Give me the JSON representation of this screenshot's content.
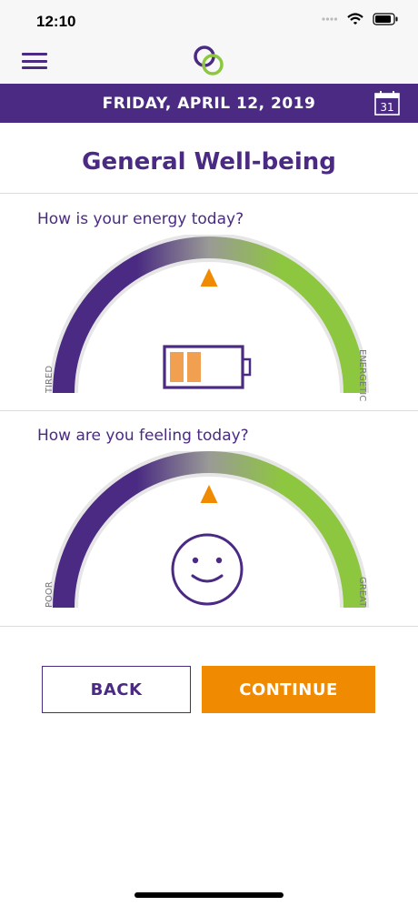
{
  "status": {
    "time": "12:10"
  },
  "header": {
    "date": "FRIDAY, APRIL 12, 2019",
    "calendar_day": "31"
  },
  "page": {
    "title": "General Well-being"
  },
  "energy": {
    "question": "How is your energy today?",
    "left_label": "TIRED",
    "right_label": "ENERGETIC",
    "level": 0.5,
    "icon": "battery-icon"
  },
  "feeling": {
    "question": "How are you feeling today?",
    "left_label": "POOR",
    "right_label": "GREAT",
    "level": 0.5,
    "icon": "smiley-face-icon"
  },
  "actions": {
    "back_label": "BACK",
    "continue_label": "CONTINUE"
  },
  "colors": {
    "brand_purple": "#4a2a82",
    "accent_orange": "#f08a00",
    "gauge_green": "#8dc63f",
    "gauge_track": "#e6e6e6"
  }
}
